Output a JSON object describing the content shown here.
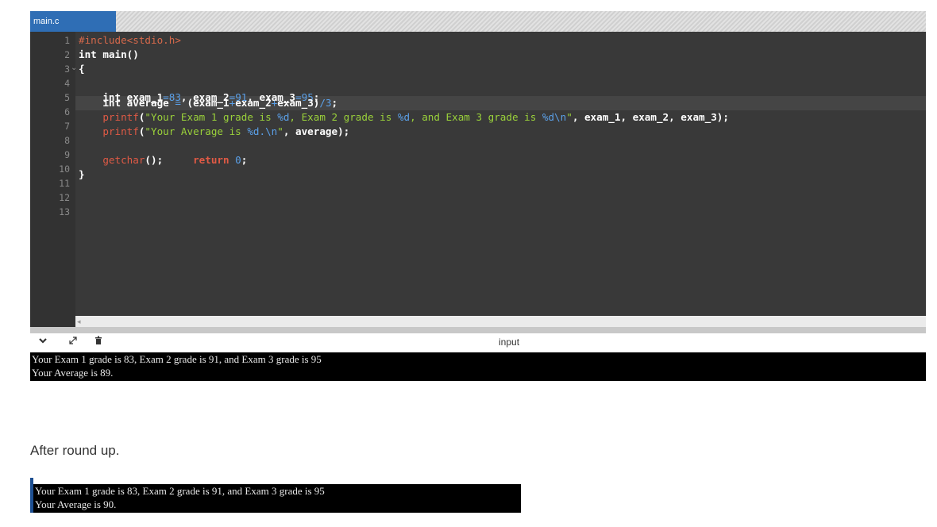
{
  "editor": {
    "tab_label": "main.c",
    "line_numbers": [
      "1",
      "2",
      "3",
      "4",
      "5",
      "6",
      "7",
      "8",
      "9",
      "10",
      "11",
      "12",
      "13"
    ],
    "lines": {
      "l1_pp": "#include<stdio.h>",
      "l2": "int main()",
      "l3": "{",
      "l4_a": "    int exam_1",
      "l4_b": "=",
      "l4_c": "83",
      "l4_d": ", exam_2",
      "l4_e": "=",
      "l4_f": "91",
      "l4_g": ", exam_3",
      "l4_h": "=",
      "l4_i": "95",
      "l4_j": ";",
      "l5_a": "    int average ",
      "l5_b": "=",
      "l5_c": " (exam_1",
      "l5_d": "+",
      "l5_e": "exam_2",
      "l5_f": "+",
      "l5_g": "exam_3)",
      "l5_h": "/",
      "l5_i": "3",
      "l5_j": ";",
      "l6_fn": "    printf",
      "l6_p": "(",
      "l6_s1": "\"Your Exam 1 grade is ",
      "l6_e1": "%d",
      "l6_s2": ", Exam 2 grade is ",
      "l6_e2": "%d",
      "l6_s3": ", and Exam 3 grade is ",
      "l6_e3": "%d\\n",
      "l6_s4": "\"",
      "l6_rest": ", exam_1, exam_2, exam_3);",
      "l7_fn": "    printf",
      "l7_p": "(",
      "l7_s1": "\"Your Average is ",
      "l7_e1": "%d.\\n",
      "l7_s2": "\"",
      "l7_rest": ", average);",
      "l9_fn": "    getchar",
      "l9_mid": "();     ",
      "l9_ret": "return",
      "l9_sp": " ",
      "l9_num": "0",
      "l9_end": ";",
      "l10": "}"
    }
  },
  "io_panel": {
    "label": "input",
    "icons": [
      "chevron-down-icon",
      "expand-icon",
      "clear-icon"
    ]
  },
  "console_output": {
    "line1": "Your Exam 1 grade is 83, Exam 2 grade is 91, and Exam 3 grade is 95",
    "line2": "Your Average is 89."
  },
  "caption": "After round up.",
  "console_output_rounded": {
    "line1": "Your Exam 1 grade is 83, Exam 2 grade is 91, and Exam 3 grade is 95",
    "line2": "Your Average is 90."
  }
}
